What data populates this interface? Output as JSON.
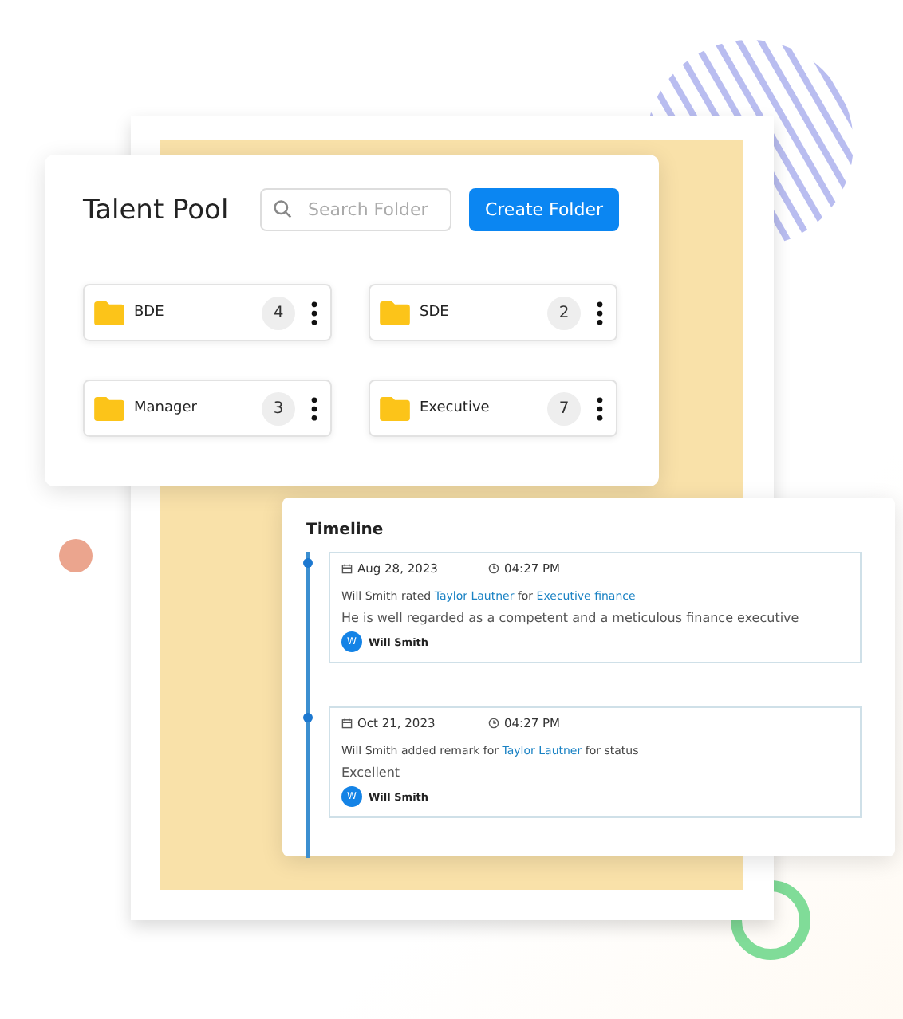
{
  "talent_pool": {
    "title": "Talent Pool",
    "search": {
      "placeholder": "Search Folder"
    },
    "create_button": "Create Folder",
    "folders": [
      {
        "name": "BDE",
        "count": "4"
      },
      {
        "name": "SDE",
        "count": "2"
      },
      {
        "name": "Manager",
        "count": "3"
      },
      {
        "name": "Executive",
        "count": "7"
      }
    ]
  },
  "timeline": {
    "title": "Timeline",
    "entries": [
      {
        "date": "Aug 28, 2023",
        "time": "04:27 PM",
        "action": [
          {
            "kind": "plain",
            "text": "Will Smith rated "
          },
          {
            "kind": "link",
            "text": "Taylor Lautner"
          },
          {
            "kind": "plain",
            "text": " for "
          },
          {
            "kind": "link",
            "text": "Executive finance"
          }
        ],
        "note": "He is well regarded as a competent and a meticulous finance executive",
        "author": {
          "initial": "W",
          "name": "Will Smith"
        }
      },
      {
        "date": "Oct 21, 2023",
        "time": "04:27 PM",
        "action": [
          {
            "kind": "plain",
            "text": "Will Smith added remark for "
          },
          {
            "kind": "link",
            "text": "Taylor Lautner"
          },
          {
            "kind": "plain",
            "text": " for status"
          }
        ],
        "note": "Excellent",
        "author": {
          "initial": "W",
          "name": "Will Smith"
        }
      }
    ]
  }
}
